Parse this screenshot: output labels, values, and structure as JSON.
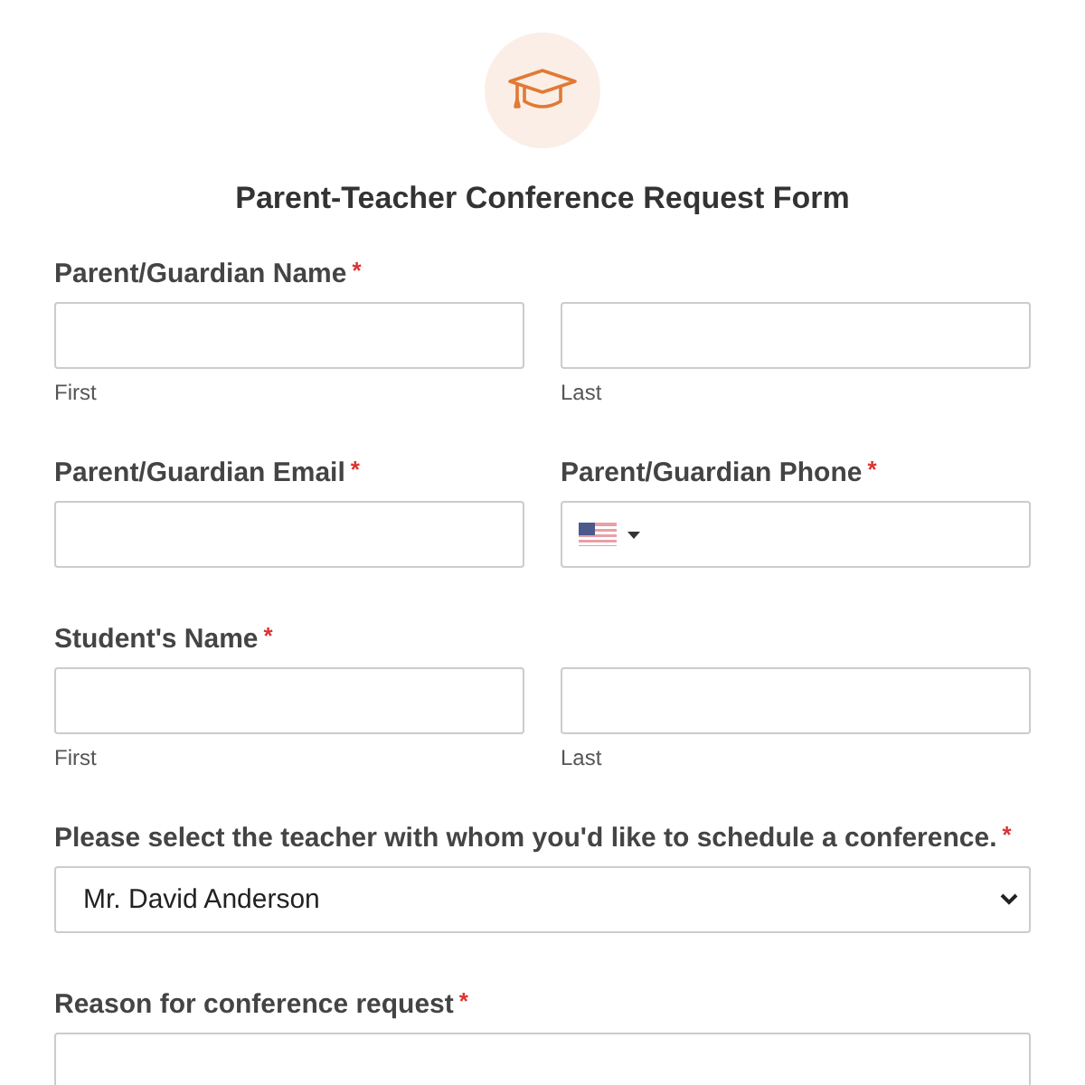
{
  "header": {
    "title": "Parent-Teacher Conference Request Form"
  },
  "required_mark": "*",
  "fields": [
    {
      "kind": "name",
      "label": "Parent/Guardian Name",
      "required": true,
      "sublabels": [
        "First",
        "Last"
      ]
    },
    {
      "kind": "pair",
      "items": [
        {
          "kind": "text",
          "label": "Parent/Guardian Email",
          "required": true
        },
        {
          "kind": "phone",
          "label": "Parent/Guardian Phone",
          "required": true
        }
      ]
    },
    {
      "kind": "name",
      "label": "Student's Name",
      "required": true,
      "sublabels": [
        "First",
        "Last"
      ]
    },
    {
      "kind": "select",
      "label": "Please select the teacher with whom you'd like to schedule a conference.",
      "required": true,
      "value": "Mr. David Anderson"
    },
    {
      "kind": "textarea",
      "label": "Reason for conference request",
      "required": true
    }
  ]
}
